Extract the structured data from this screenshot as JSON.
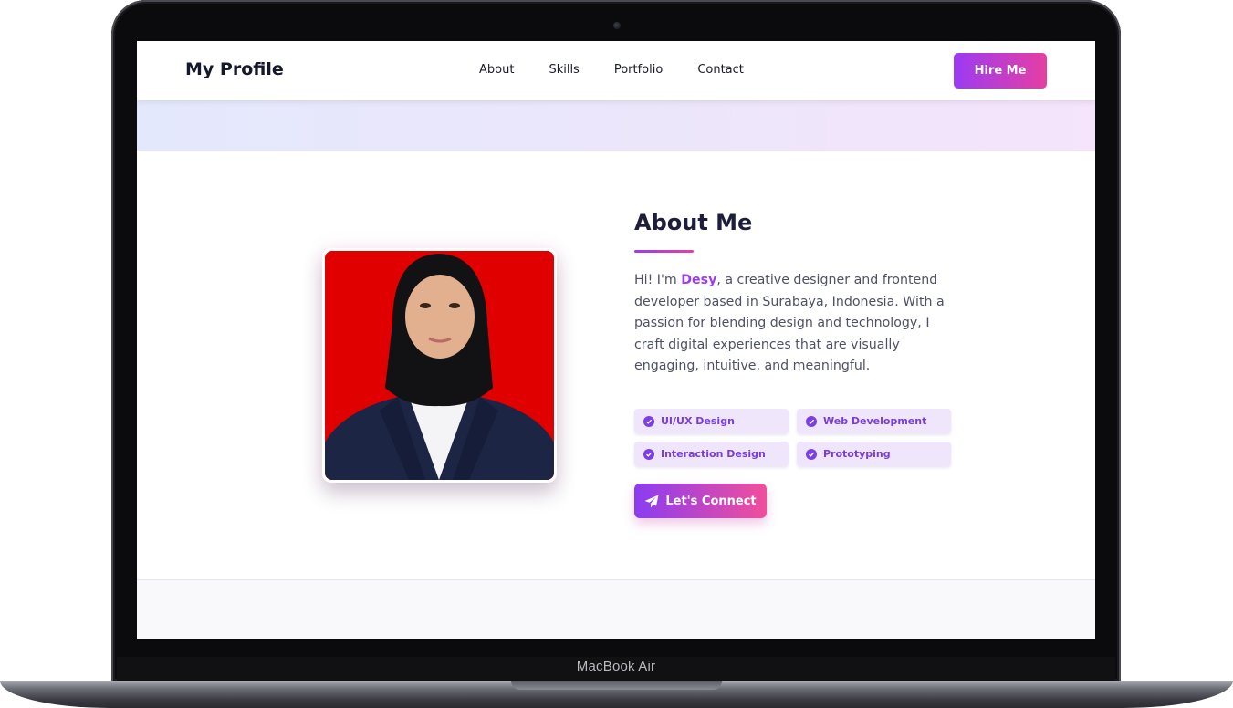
{
  "navbar": {
    "brand": "My Profile",
    "links": [
      "About",
      "Skills",
      "Portfolio",
      "Contact"
    ],
    "cta": "Hire Me"
  },
  "about": {
    "title": "About Me",
    "intro_prefix": "Hi! I'm ",
    "name": "Desy",
    "intro_suffix": ", a creative designer and frontend developer based in Surabaya, Indonesia. With a passion for blending design and technology, I craft digital experiences that are visually engaging, intuitive, and meaningful.",
    "tags": [
      "UI/UX Design",
      "Web Development",
      "Interaction Design",
      "Prototyping"
    ],
    "connect_button": "Let's Connect"
  },
  "device": {
    "model_label": "MacBook Air"
  },
  "colors": {
    "accent_purple": "#9b3bf2",
    "accent_pink": "#e63fa3",
    "photo_background": "#e00000",
    "tag_background": "#efe6fc"
  },
  "icons": {
    "tag_icon": "check-circle-icon",
    "connect_icon": "paper-plane-icon"
  }
}
